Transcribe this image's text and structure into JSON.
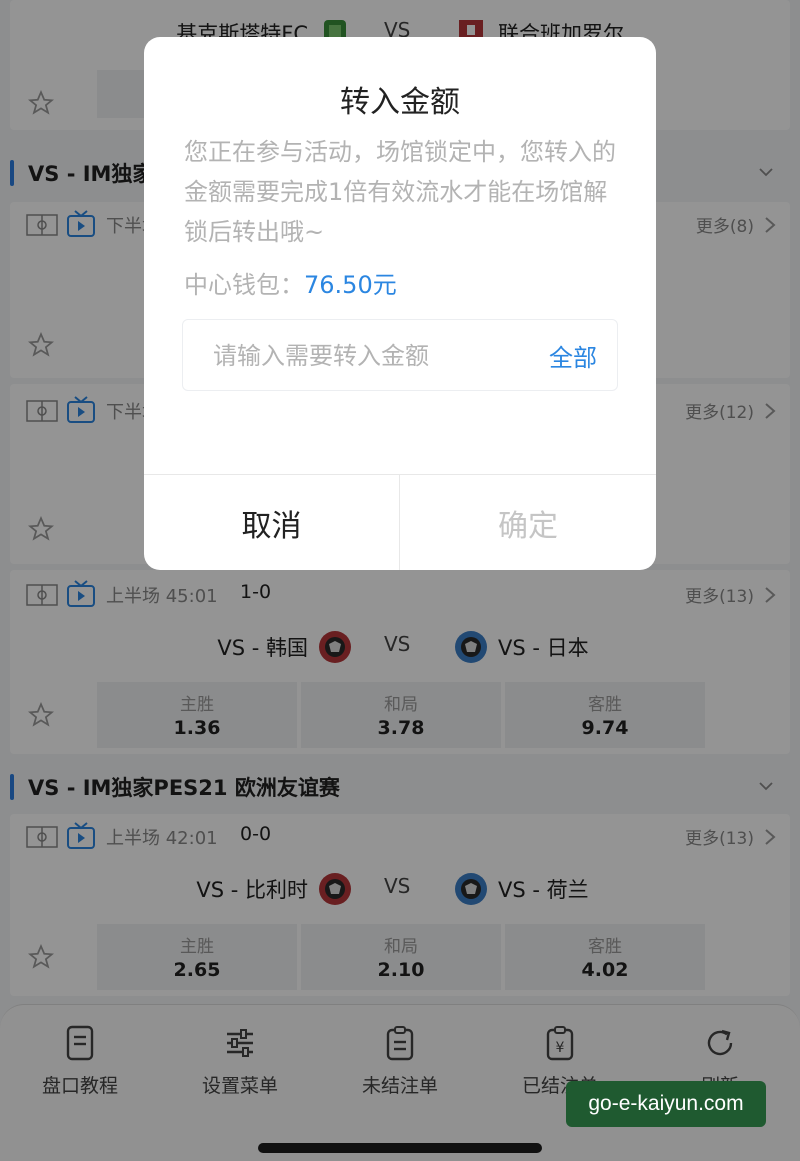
{
  "top_match": {
    "home": "基克斯塔特FC",
    "vs": "VS",
    "away": "联合班加罗尔"
  },
  "league1": {
    "name": "VS - IM独家PES21 欧洲友谊赛"
  },
  "match_a": {
    "half": "下半场",
    "more": "更多(8)"
  },
  "match_b": {
    "half": "下半场",
    "more": "更多(12)"
  },
  "match_c": {
    "half": "上半场 45:01",
    "score": "1-0",
    "more": "更多(13)",
    "home": "VS - 韩国",
    "vs": "VS",
    "away": "VS - 日本",
    "odds": [
      {
        "label": "主胜",
        "value": "1.36"
      },
      {
        "label": "和局",
        "value": "3.78"
      },
      {
        "label": "客胜",
        "value": "9.74"
      }
    ]
  },
  "league2": {
    "name": "VS - IM独家PES21 欧洲友谊赛"
  },
  "match_d": {
    "half": "上半场 42:01",
    "score": "0-0",
    "more": "更多(13)",
    "home": "VS - 比利时",
    "vs": "VS",
    "away": "VS - 荷兰",
    "odds": [
      {
        "label": "主胜",
        "value": "2.65"
      },
      {
        "label": "和局",
        "value": "2.10"
      },
      {
        "label": "客胜",
        "value": "4.02"
      }
    ]
  },
  "dialog": {
    "title": "转入金额",
    "message": "您正在参与活动，场馆锁定中，您转入的金额需要完成1倍有效流水才能在场馆解锁后转出哦~",
    "wallet_label": "中心钱包：",
    "wallet_amount": "76.50元",
    "input_placeholder": "请输入需要转入金额",
    "all_label": "全部",
    "cancel_label": "取消",
    "confirm_label": "确定"
  },
  "tabbar": [
    {
      "label": "盘口教程",
      "icon": "document-icon"
    },
    {
      "label": "设置菜单",
      "icon": "sliders-icon"
    },
    {
      "label": "未结注单",
      "icon": "clipboard-icon"
    },
    {
      "label": "已结注单",
      "icon": "yen-clipboard-icon"
    },
    {
      "label": "刷新",
      "icon": "refresh-icon"
    }
  ],
  "watermark": "go-e-kaiyun.com",
  "colors": {
    "accent": "#2b86e1",
    "league_bar": "#2b7de1"
  }
}
